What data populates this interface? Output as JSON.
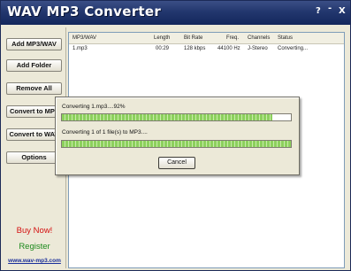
{
  "window": {
    "title": "WAV MP3 Converter",
    "help_label": "?",
    "minimize_label": "-",
    "close_label": "X"
  },
  "sidebar": {
    "buttons": [
      {
        "label": "Add MP3/WAV"
      },
      {
        "label": "Add Folder"
      },
      {
        "label": "Remove All"
      },
      {
        "label": "Convert to MP3"
      },
      {
        "label": "Convert to WAV"
      },
      {
        "label": "Options"
      }
    ],
    "buy_now": "Buy Now!",
    "register": "Register",
    "website": "www.wav-mp3.com"
  },
  "table": {
    "columns": [
      "MP3/WAV",
      "Length",
      "Bit Rate",
      "Freq.",
      "Channels",
      "Status"
    ],
    "rows": [
      {
        "file": "1.mp3",
        "length": "00:29",
        "bitrate": "128 kbps",
        "freq": "44100 Hz",
        "channels": "J-Stereo",
        "status": "Converting..."
      }
    ]
  },
  "progress_dialog": {
    "file_progress_text": "Converting 1.mp3....92%",
    "file_progress": 0.92,
    "total_progress_text": "Converting 1 of 1 file(s) to MP3....",
    "total_progress": 1.0,
    "cancel_label": "Cancel"
  },
  "colors": {
    "title_bar": "#22376e",
    "progress_fill": "#8cd05d",
    "buy_now": "#d41010",
    "register": "#1d8a1d",
    "link": "#1a2f9a"
  }
}
